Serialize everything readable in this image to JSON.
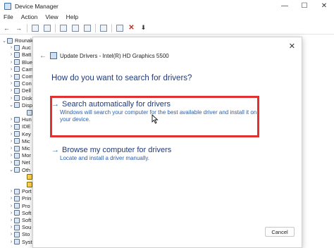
{
  "window": {
    "title": "Device Manager",
    "minimize": "—",
    "maximize": "☐",
    "close": "✕"
  },
  "menu": [
    "File",
    "Action",
    "View",
    "Help"
  ],
  "toolbar": {
    "back": "←",
    "forward": "→",
    "remove": "✕",
    "update": "⬇"
  },
  "tree": [
    {
      "chevron": "⌄",
      "label": "Rounak",
      "icon": "computer-icon"
    },
    {
      "chevron": "›",
      "label": "Auc",
      "icon": "audio-icon"
    },
    {
      "chevron": "›",
      "label": "Batt",
      "icon": "battery-icon"
    },
    {
      "chevron": "›",
      "label": "Blue",
      "icon": "bluetooth-icon"
    },
    {
      "chevron": "›",
      "label": "Cam",
      "icon": "camera-icon"
    },
    {
      "chevron": "›",
      "label": "Com",
      "icon": "computer-icon"
    },
    {
      "chevron": "›",
      "label": "Con",
      "icon": "controller-icon"
    },
    {
      "chevron": "›",
      "label": "Dell",
      "icon": "device-icon"
    },
    {
      "chevron": "›",
      "label": "Disk",
      "icon": "disk-icon"
    },
    {
      "chevron": "⌄",
      "label": "Disp",
      "icon": "display-icon"
    },
    {
      "chevron": "",
      "label": "",
      "icon": "display-adapter-icon"
    },
    {
      "chevron": "›",
      "label": "Hun",
      "icon": "hid-icon"
    },
    {
      "chevron": "›",
      "label": "IDE",
      "icon": "ide-icon"
    },
    {
      "chevron": "›",
      "label": "Key",
      "icon": "keyboard-icon"
    },
    {
      "chevron": "›",
      "label": "Mic",
      "icon": "microphone-icon"
    },
    {
      "chevron": "›",
      "label": "Mic",
      "icon": "mouse-icon"
    },
    {
      "chevron": "›",
      "label": "Mor",
      "icon": "monitor-icon"
    },
    {
      "chevron": "›",
      "label": "Net",
      "icon": "network-icon"
    },
    {
      "chevron": "⌄",
      "label": "Oth",
      "icon": "other-devices-icon"
    },
    {
      "chevron": "",
      "label": "",
      "icon": "warning-device-icon"
    },
    {
      "chevron": "",
      "label": "",
      "icon": "warning-device-icon"
    },
    {
      "chevron": "›",
      "label": "Port",
      "icon": "port-icon"
    },
    {
      "chevron": "›",
      "label": "Prin",
      "icon": "printer-icon"
    },
    {
      "chevron": "›",
      "label": "Pro",
      "icon": "processor-icon"
    },
    {
      "chevron": "›",
      "label": "Soft",
      "icon": "software-icon"
    },
    {
      "chevron": "›",
      "label": "Soft",
      "icon": "software-icon"
    },
    {
      "chevron": "›",
      "label": "Sou",
      "icon": "sound-icon"
    },
    {
      "chevron": "›",
      "label": "Sto",
      "icon": "storage-icon"
    },
    {
      "chevron": "›",
      "label": "System devices",
      "icon": "system-icon"
    }
  ],
  "dialog": {
    "back_arrow": "←",
    "title": "Update Drivers - Intel(R) HD Graphics 5500",
    "close": "✕",
    "question": "How do you want to search for drivers?",
    "option_auto": {
      "arrow": "→",
      "title": "Search automatically for drivers",
      "description": "Windows will search your computer for the best available driver and install it on your device."
    },
    "option_browse": {
      "arrow": "→",
      "title": "Browse my computer for drivers",
      "description": "Locate and install a driver manually."
    },
    "cancel_label": "Cancel"
  },
  "colors": {
    "highlight_border": "#e03030",
    "link_blue": "#1f3a7a"
  }
}
